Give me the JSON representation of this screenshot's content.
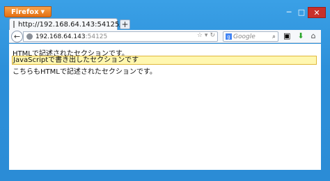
{
  "browser": {
    "app_button_label": "Firefox",
    "tab_title": "http://192.168.64.143:54125/",
    "new_tab_label": "+",
    "url_host": "192.168.64.143",
    "url_port": ":54125",
    "search_placeholder": "Google"
  },
  "window_controls": {
    "minimize": "─",
    "maximize": "□",
    "close": "✕"
  },
  "content": {
    "line1": "HTMLで記述されたセクションです。",
    "line2": "JavaScriptで書き出したセクションです",
    "line3": "こちらもHTMLで記述されたセクションです。"
  },
  "colors": {
    "highlight_bg": "#fff7b0",
    "highlight_border": "#e0b83a",
    "frame": "#2b8cd6"
  }
}
